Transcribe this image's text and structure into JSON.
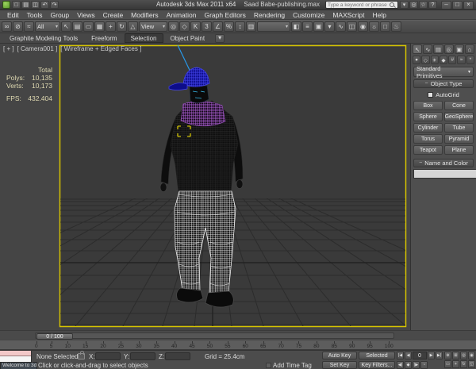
{
  "colors": {
    "safe_frame_yellow": "#d6c400",
    "selection_bracket_yellow": "#f0e000",
    "cap_blue": "#4545f0",
    "scarf_purple": "#b060d8",
    "helper_blue": "#2898e8",
    "pants_wire": "#f0f0f0",
    "viewport_bg": "#3a3a3a"
  },
  "title_bar": {
    "app_title": "Autodesk 3ds Max 2011 x64",
    "doc_title": "Saad Babe-publishing.max",
    "search_placeholder": "Type a keyword or phrase",
    "quick_icons": [
      {
        "name": "new-scene-icon",
        "glyph": "□"
      },
      {
        "name": "open-file-icon",
        "glyph": "▤"
      },
      {
        "name": "save-file-icon",
        "glyph": "◫"
      },
      {
        "name": "undo-icon",
        "glyph": "↶"
      },
      {
        "name": "redo-icon",
        "glyph": "↷"
      }
    ],
    "info_icons": [
      {
        "name": "search-dropdown-icon",
        "glyph": "▾"
      },
      {
        "name": "communication-center-icon",
        "glyph": "◎"
      },
      {
        "name": "favorites-icon",
        "glyph": "☆"
      },
      {
        "name": "help-icon",
        "glyph": "?"
      }
    ],
    "window_buttons": [
      {
        "name": "minimize-button",
        "glyph": "–"
      },
      {
        "name": "maximize-button",
        "glyph": "□"
      },
      {
        "name": "close-button",
        "glyph": "×"
      }
    ]
  },
  "menu_bar": {
    "items": [
      "Edit",
      "Tools",
      "Group",
      "Views",
      "Create",
      "Modifiers",
      "Animation",
      "Graph Editors",
      "Rendering",
      "Customize",
      "MAXScript",
      "Help"
    ]
  },
  "main_toolbar": {
    "items": [
      {
        "type": "icon",
        "name": "select-and-link-icon",
        "glyph": "∞"
      },
      {
        "type": "icon",
        "name": "unlink-selection-icon",
        "glyph": "⊘"
      },
      {
        "type": "icon",
        "name": "bind-to-space-warp-icon",
        "glyph": "≈"
      },
      {
        "type": "dropdown",
        "name": "selection-filter-dropdown",
        "label": "All"
      },
      {
        "type": "icon",
        "name": "select-object-icon",
        "glyph": "↖"
      },
      {
        "type": "icon",
        "name": "select-by-name-icon",
        "glyph": "▤"
      },
      {
        "type": "icon",
        "name": "rectangular-selection-region-icon",
        "glyph": "▭"
      },
      {
        "type": "icon",
        "name": "window-crossing-icon",
        "glyph": "▦"
      },
      {
        "type": "icon",
        "name": "select-and-move-icon",
        "glyph": "+"
      },
      {
        "type": "icon",
        "name": "select-and-rotate-icon",
        "glyph": "↻"
      },
      {
        "type": "icon",
        "name": "select-and-scale-icon",
        "glyph": "△"
      },
      {
        "type": "dropdown",
        "name": "reference-coordinate-system-dropdown",
        "label": "View"
      },
      {
        "type": "icon",
        "name": "use-pivot-point-center-icon",
        "glyph": "◎"
      },
      {
        "type": "icon",
        "name": "select-and-manipulate-icon",
        "glyph": "◇"
      },
      {
        "type": "icon",
        "name": "keyboard-shortcut-override-icon",
        "glyph": "K"
      },
      {
        "type": "icon",
        "name": "snap-toggle-icon",
        "glyph": "3"
      },
      {
        "type": "icon",
        "name": "angle-snap-toggle-icon",
        "glyph": "∠"
      },
      {
        "type": "icon",
        "name": "percent-snap-toggle-icon",
        "glyph": "%"
      },
      {
        "type": "icon",
        "name": "spinner-snap-toggle-icon",
        "glyph": "↕"
      },
      {
        "type": "icon",
        "name": "edit-named-selection-sets-icon",
        "glyph": "▥"
      },
      {
        "type": "dropdown",
        "name": "named-selection-sets-dropdown",
        "label": ""
      },
      {
        "type": "icon",
        "name": "mirror-icon",
        "glyph": "◧"
      },
      {
        "type": "icon",
        "name": "align-icon",
        "glyph": "≡"
      },
      {
        "type": "icon",
        "name": "layer-manager-icon",
        "glyph": "▣"
      },
      {
        "type": "icon",
        "name": "graphite-ribbon-toggle-icon",
        "glyph": "▾"
      },
      {
        "type": "icon",
        "name": "curve-editor-icon",
        "glyph": "∿"
      },
      {
        "type": "icon",
        "name": "schematic-view-icon",
        "glyph": "◫"
      },
      {
        "type": "icon",
        "name": "material-editor-icon",
        "glyph": "◉"
      },
      {
        "type": "icon",
        "name": "render-setup-icon",
        "glyph": "☼"
      },
      {
        "type": "icon",
        "name": "rendered-frame-window-icon",
        "glyph": "□"
      },
      {
        "type": "icon",
        "name": "render-production-icon",
        "glyph": "♨"
      }
    ]
  },
  "ribbon": {
    "tabs": [
      {
        "label": "Graphite Modeling Tools",
        "active": false
      },
      {
        "label": "Freeform",
        "active": false
      },
      {
        "label": "Selection",
        "active": true
      },
      {
        "label": "Object Paint",
        "active": false
      }
    ]
  },
  "viewport": {
    "label_segments": [
      "[ + ]",
      "[ Camera001 ]",
      "[ Wireframe + Edged Faces ]"
    ],
    "stats": {
      "total_label": "Total",
      "polys_label": "Polys:",
      "polys_value": "10,135",
      "verts_label": "Verts:",
      "verts_value": "10,173",
      "fps_label": "FPS:",
      "fps_value": "432.404"
    }
  },
  "command_panel": {
    "tabs": [
      {
        "name": "create-tab-icon",
        "glyph": "↖"
      },
      {
        "name": "modify-tab-icon",
        "glyph": "∿"
      },
      {
        "name": "hierarchy-tab-icon",
        "glyph": "▤"
      },
      {
        "name": "motion-tab-icon",
        "glyph": "◎"
      },
      {
        "name": "display-tab-icon",
        "glyph": "▣"
      },
      {
        "name": "utilities-tab-icon",
        "glyph": "⌂"
      }
    ],
    "categories": [
      {
        "name": "geometry-category-icon",
        "glyph": "●"
      },
      {
        "name": "shapes-category-icon",
        "glyph": "◇"
      },
      {
        "name": "lights-category-icon",
        "glyph": "☀"
      },
      {
        "name": "cameras-category-icon",
        "glyph": "◆"
      },
      {
        "name": "helpers-category-icon",
        "glyph": "#"
      },
      {
        "name": "space-warps-category-icon",
        "glyph": "≈"
      },
      {
        "name": "systems-category-icon",
        "glyph": "*"
      }
    ],
    "primitive_dropdown": "Standard Primitives",
    "object_type_rollout": "Object Type",
    "autogrid_label": "AutoGrid",
    "primitive_buttons": [
      "Box",
      "Cone",
      "Sphere",
      "GeoSphere",
      "Cylinder",
      "Tube",
      "Torus",
      "Pyramid",
      "Teapot",
      "Plane"
    ],
    "name_color_rollout": "Name and Color",
    "object_name_value": ""
  },
  "timeline": {
    "handle_label": "0 / 100",
    "ticks": [
      "0",
      "5",
      "10",
      "15",
      "20",
      "25",
      "30",
      "35",
      "40",
      "45",
      "50",
      "55",
      "60",
      "65",
      "70",
      "75",
      "80",
      "85",
      "90",
      "95",
      "100"
    ]
  },
  "status_bar": {
    "selection_status": "None Selected",
    "x_label": "X:",
    "y_label": "Y:",
    "z_label": "Z:",
    "x_value": "",
    "y_value": "",
    "z_value": "",
    "grid_size": "Grid = 25.4cm",
    "prompt": "Click or click-and-drag to select objects",
    "add_time_tag": "Add Time Tag",
    "auto_key_label": "Auto Key",
    "set_key_label": "Set Key",
    "key_mode_dropdown": "Selected",
    "key_filters_label": "Key Filters...",
    "frame_field": "0",
    "welcome_window_title": "Welcome to 3d",
    "transport_row1": [
      {
        "name": "go-to-start-button",
        "glyph": "|◀"
      },
      {
        "name": "previous-frame-button",
        "glyph": "◀"
      },
      {
        "name": "play-animation-button",
        "glyph": "▶"
      },
      {
        "name": "go-to-end-button",
        "glyph": "▶|"
      }
    ],
    "transport_row2": [
      {
        "name": "previous-key-button",
        "glyph": "◀|"
      },
      {
        "name": "key-mode-toggle-icon",
        "glyph": "◆"
      },
      {
        "name": "next-key-button",
        "glyph": "|▶"
      },
      {
        "name": "time-configuration-icon",
        "glyph": "◔"
      }
    ],
    "nav_buttons": [
      {
        "name": "zoom-icon",
        "glyph": "⊕"
      },
      {
        "name": "zoom-all-icon",
        "glyph": "⊞"
      },
      {
        "name": "zoom-extents-icon",
        "glyph": "◎"
      },
      {
        "name": "zoom-extents-all-icon",
        "glyph": "◉"
      },
      {
        "name": "zoom-region-icon",
        "glyph": "▭"
      },
      {
        "name": "pan-view-icon",
        "glyph": "+"
      },
      {
        "name": "orbit-icon",
        "glyph": "↻"
      },
      {
        "name": "maximize-viewport-toggle-icon",
        "glyph": "◱"
      }
    ]
  }
}
